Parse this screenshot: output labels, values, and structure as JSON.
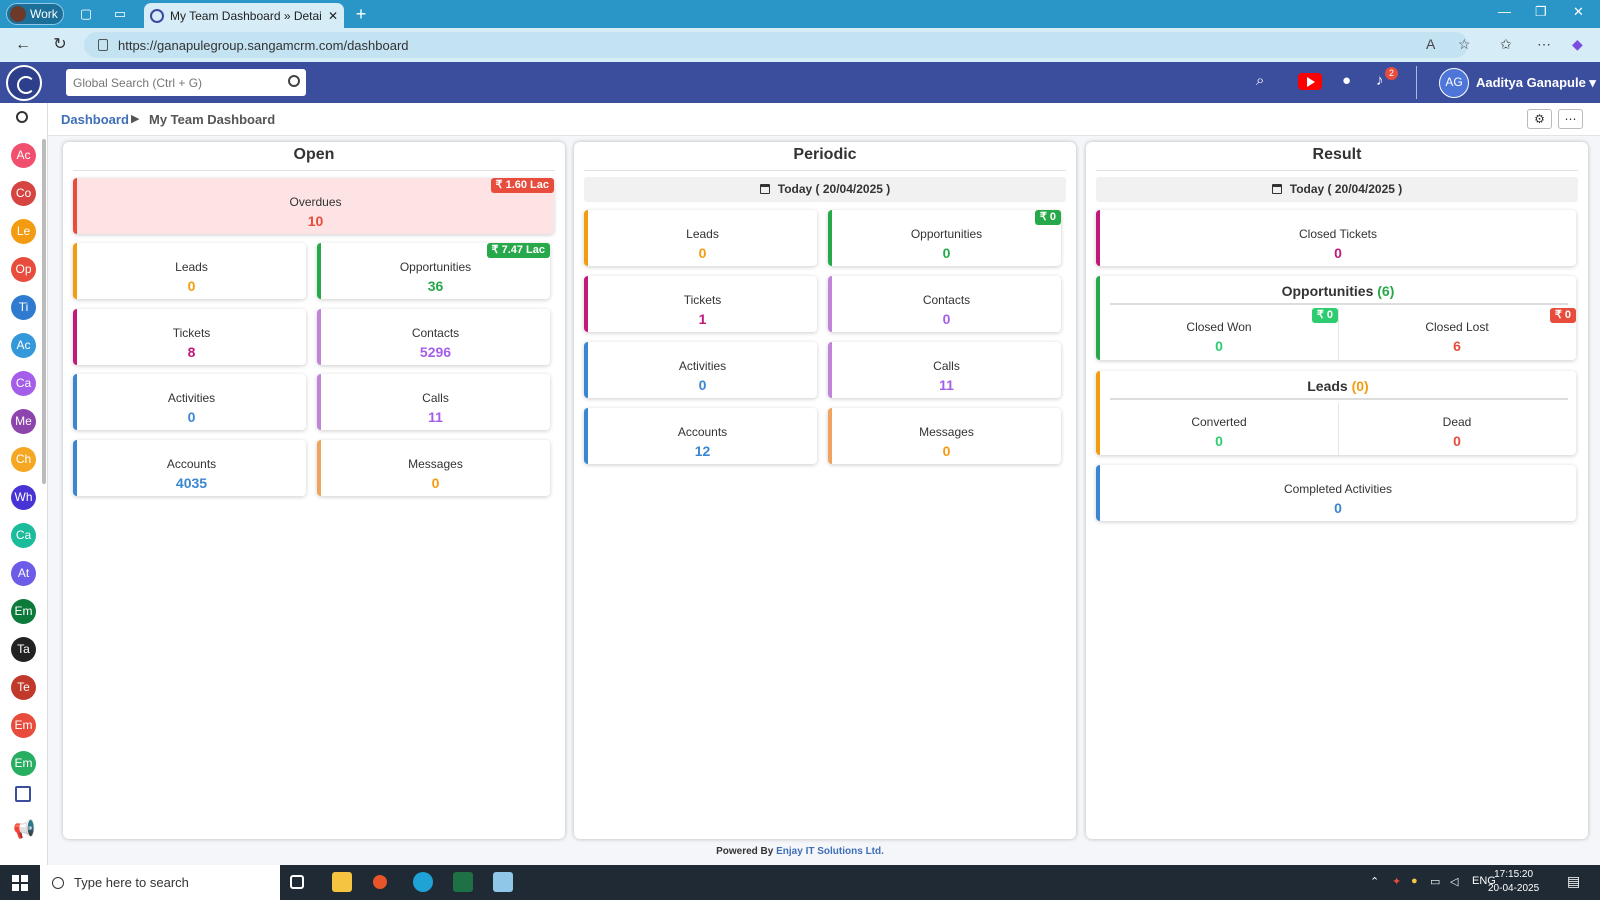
{
  "browser": {
    "profile": "Work",
    "tab_title": "My Team Dashboard » Details || S",
    "url": "https://ganapulegroup.sangamcrm.com/dashboard"
  },
  "header": {
    "search_placeholder": "Global Search (Ctrl + G)",
    "notifications_count": "2",
    "avatar_initials": "AG",
    "user_name": "Aaditya Ganapule"
  },
  "sidebar": {
    "modules": [
      {
        "abbr": "Ac",
        "color": "#f0506e"
      },
      {
        "abbr": "Co",
        "color": "#d64541"
      },
      {
        "abbr": "Le",
        "color": "#f39c12"
      },
      {
        "abbr": "Op",
        "color": "#e74c3c"
      },
      {
        "abbr": "Ti",
        "color": "#2e7bcf"
      },
      {
        "abbr": "Ac",
        "color": "#3498db"
      },
      {
        "abbr": "Ca",
        "color": "#a55eea"
      },
      {
        "abbr": "Me",
        "color": "#8e44ad"
      },
      {
        "abbr": "Ch",
        "color": "#f5a623"
      },
      {
        "abbr": "Wh",
        "color": "#4834d4"
      },
      {
        "abbr": "Ca",
        "color": "#1abc9c"
      },
      {
        "abbr": "At",
        "color": "#6c5ce7"
      },
      {
        "abbr": "Em",
        "color": "#0b7a3b"
      },
      {
        "abbr": "Ta",
        "color": "#222222"
      },
      {
        "abbr": "Te",
        "color": "#c0392b"
      },
      {
        "abbr": "Em",
        "color": "#e74c3c"
      },
      {
        "abbr": "Em",
        "color": "#27ae60"
      }
    ]
  },
  "breadcrumb": {
    "root": "Dashboard",
    "current": "My Team Dashboard"
  },
  "open": {
    "title": "Open",
    "overdues": {
      "label": "Overdues",
      "value": "10",
      "badge": "₹ 1.60 Lac"
    },
    "leads": {
      "label": "Leads",
      "value": "0"
    },
    "opportunities": {
      "label": "Opportunities",
      "value": "36",
      "badge": "₹ 7.47 Lac"
    },
    "tickets": {
      "label": "Tickets",
      "value": "8"
    },
    "contacts": {
      "label": "Contacts",
      "value": "5296"
    },
    "activities": {
      "label": "Activities",
      "value": "0"
    },
    "calls": {
      "label": "Calls",
      "value": "11"
    },
    "accounts": {
      "label": "Accounts",
      "value": "4035"
    },
    "messages": {
      "label": "Messages",
      "value": "0"
    }
  },
  "periodic": {
    "title": "Periodic",
    "date": "Today ( 20/04/2025 )",
    "leads": {
      "label": "Leads",
      "value": "0"
    },
    "opportunities": {
      "label": "Opportunities",
      "value": "0",
      "badge": "₹ 0"
    },
    "tickets": {
      "label": "Tickets",
      "value": "1"
    },
    "contacts": {
      "label": "Contacts",
      "value": "0"
    },
    "activities": {
      "label": "Activities",
      "value": "0"
    },
    "calls": {
      "label": "Calls",
      "value": "11"
    },
    "accounts": {
      "label": "Accounts",
      "value": "12"
    },
    "messages": {
      "label": "Messages",
      "value": "0"
    }
  },
  "result": {
    "title": "Result",
    "date": "Today ( 20/04/2025 )",
    "closed_tickets": {
      "label": "Closed Tickets",
      "value": "0"
    },
    "opportunities": {
      "label": "Opportunities",
      "count": "(6)",
      "won": {
        "label": "Closed Won",
        "value": "0",
        "badge": "₹ 0"
      },
      "lost": {
        "label": "Closed Lost",
        "value": "6",
        "badge": "₹ 0"
      }
    },
    "leads": {
      "label": "Leads",
      "count": "(0)",
      "converted": {
        "label": "Converted",
        "value": "0"
      },
      "dead": {
        "label": "Dead",
        "value": "0"
      }
    },
    "completed_activities": {
      "label": "Completed Activities",
      "value": "0"
    }
  },
  "footer": {
    "prefix": "Powered By",
    "company": "Enjay IT Solutions Ltd."
  },
  "taskbar": {
    "search_placeholder": "Type here to search",
    "language": "ENG",
    "time": "17:15:20",
    "date": "20-04-2025"
  },
  "colors": {
    "header": "#3b4e9e",
    "orange": "#f39c12",
    "green": "#27a84a",
    "pink": "#c2187a",
    "purple": "#a55eea",
    "blue": "#3a86d1",
    "red": "#e74c3c"
  }
}
